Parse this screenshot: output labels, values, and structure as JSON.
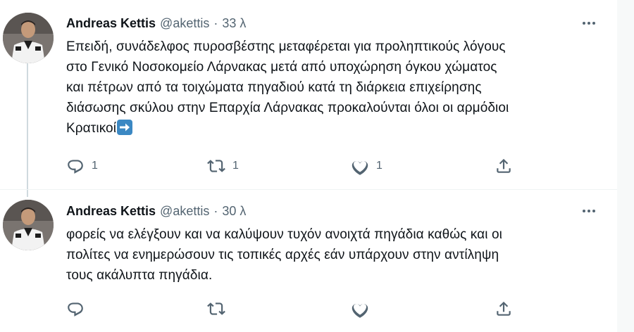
{
  "tweets": [
    {
      "author_name": "Andreas Kettis",
      "handle": "@akettis",
      "separator": "·",
      "time": "33 λ",
      "text_lines": [
        "Επειδή, συνάδελφος πυροσβέστης μεταφέρεται για προληπτικούς λόγους",
        "στο Γενικό Νοσοκομείο Λάρνακας μετά από υποχώρηση όγκου χώματος",
        "και πέτρων από τα τοιχώματα πηγαδιού κατά τη διάρκεια επιχείρησης",
        "διάσωσης σκύλου στην Επαρχία Λάρνακας προκαλούνται όλοι οι αρμόδιοι",
        "Κρατικοί"
      ],
      "emoji": "right-arrow-emoji",
      "reply_count": "1",
      "retweet_count": "1",
      "like_count": "1"
    },
    {
      "author_name": "Andreas Kettis",
      "handle": "@akettis",
      "separator": "·",
      "time": "30 λ",
      "text_lines": [
        "φορείς να ελέγξουν και να καλύψουν τυχόν ανοιχτά πηγάδια καθώς και οι",
        "πολίτες να ενημερώσουν τις τοπικές αρχές εάν υπάρχουν στην αντίληψη",
        "τους ακάλυπτα πηγάδια."
      ],
      "reply_count": "",
      "retweet_count": "",
      "like_count": ""
    }
  ],
  "icons": {
    "more": "more-dots-icon",
    "reply": "reply-icon",
    "retweet": "retweet-icon",
    "like": "like-icon",
    "share": "share-icon"
  },
  "colors": {
    "text_primary": "#0f1419",
    "text_secondary": "#536471",
    "thread_line": "#cfd9de",
    "divider": "#eff3f4",
    "emoji_blue": "#3b88c3"
  }
}
